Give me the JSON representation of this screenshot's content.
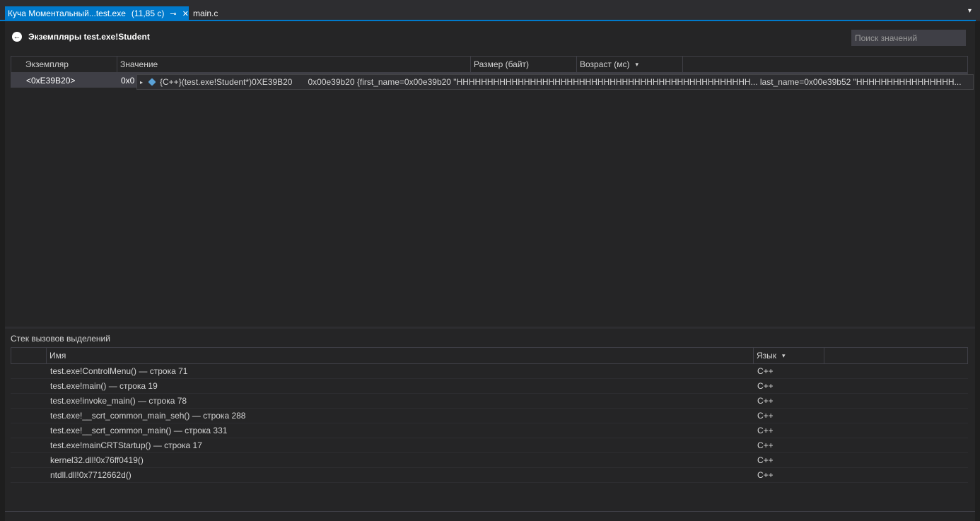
{
  "tabs": {
    "active": {
      "title": "Куча Моментальный...test.exe",
      "duration": "(11,85 с)",
      "pin_icon": "⊸",
      "close_icon": "✕"
    },
    "inactive": {
      "title": "main.c"
    },
    "dropdown_icon": "▾"
  },
  "header": {
    "back_icon": "←",
    "title": "Экземпляры test.exe!Student",
    "search_placeholder": "Поиск значений"
  },
  "instances": {
    "columns": [
      "Экземпляр",
      "Значение",
      "Размер (байт)",
      "Возраст (мс)"
    ],
    "sort_caret": "▾",
    "rows": [
      {
        "instance": "<0xE39B20>",
        "value": "0x0"
      }
    ]
  },
  "tooltip": {
    "expand_icon": "▸",
    "name": "{C++}(test.exe!Student*)0XE39B20",
    "value": "0x00e39b20 {first_name=0x00e39b20 \"НННННННННННННННННННННННННННННННННННННННННННННННН... last_name=0x00e39b52 \"НННННННННННННННН..."
  },
  "callstack": {
    "title": "Стек вызовов выделений",
    "columns": [
      "",
      "Имя",
      "Язык"
    ],
    "sort_caret": "▾",
    "rows": [
      {
        "name": "test.exe!ControlMenu() — строка 71",
        "lang": "C++"
      },
      {
        "name": "test.exe!main() — строка 19",
        "lang": "C++"
      },
      {
        "name": "test.exe!invoke_main() — строка 78",
        "lang": "C++"
      },
      {
        "name": "test.exe!__scrt_common_main_seh() — строка 288",
        "lang": "C++"
      },
      {
        "name": "test.exe!__scrt_common_main() — строка 331",
        "lang": "C++"
      },
      {
        "name": "test.exe!mainCRTStartup() — строка 17",
        "lang": "C++"
      },
      {
        "name": "kernel32.dll!0x76ff0419()",
        "lang": "C++"
      },
      {
        "name": "ntdll.dll!0x7712662d()",
        "lang": "C++"
      }
    ]
  }
}
